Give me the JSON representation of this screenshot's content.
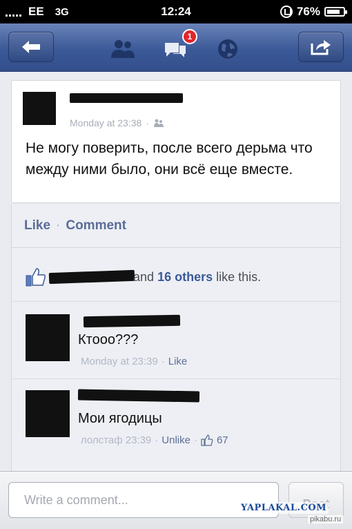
{
  "status_bar": {
    "carrier": "EE",
    "network": "3G",
    "time": "12:24",
    "battery": "76%"
  },
  "nav": {
    "notification_count": "1",
    "icons": [
      "back-arrow-icon",
      "friends-icon",
      "messages-icon",
      "globe-icon",
      "share-icon"
    ]
  },
  "post": {
    "timestamp": "Monday at 23:38",
    "separator": "·",
    "text": "Не могу поверить, после всего дерьма что между ними было, они всё еще вместе."
  },
  "actions": {
    "like": "Like",
    "dot": "·",
    "comment": "Comment"
  },
  "likes": {
    "prefix": "and",
    "others": "16 others",
    "suffix": "like this."
  },
  "comments": [
    {
      "text": "Ктооо???",
      "timestamp": "Monday at 23:39",
      "separator": "·",
      "action": "Like"
    },
    {
      "text": "Мои ягодицы",
      "timestamp": "лолстаф 23:39",
      "separator": "·",
      "action": "Unlike",
      "separator2": "·",
      "like_count": "67"
    }
  ],
  "composer": {
    "placeholder": "Write a comment...",
    "post_label": "Post"
  },
  "watermarks": {
    "site1": "YAPLAKAL.COM",
    "site2": "pikabu.ru"
  },
  "colors": {
    "facebook_blue": "#3b5998",
    "badge_red": "#e0262a"
  }
}
